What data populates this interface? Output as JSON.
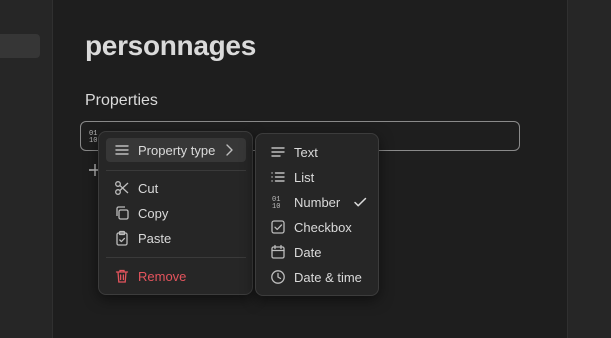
{
  "page": {
    "title": "personnages"
  },
  "properties": {
    "heading": "Properties"
  },
  "context_menu": {
    "property_type_label": "Property type",
    "cut_label": "Cut",
    "copy_label": "Copy",
    "paste_label": "Paste",
    "remove_label": "Remove"
  },
  "type_submenu": {
    "items": [
      "Text",
      "List",
      "Number",
      "Checkbox",
      "Date",
      "Date & time"
    ],
    "selected": "Number"
  },
  "colors": {
    "danger": "#e4545d",
    "background": "#1e1e1e",
    "menu": "#262626"
  },
  "icons": [
    "number-icon",
    "plus-icon",
    "lines-icon",
    "chevron-right-icon",
    "scissors-icon",
    "copy-icon",
    "clipboard-icon",
    "trash-icon",
    "list-icon",
    "checkbox-icon",
    "calendar-icon",
    "clock-icon",
    "check-icon"
  ]
}
